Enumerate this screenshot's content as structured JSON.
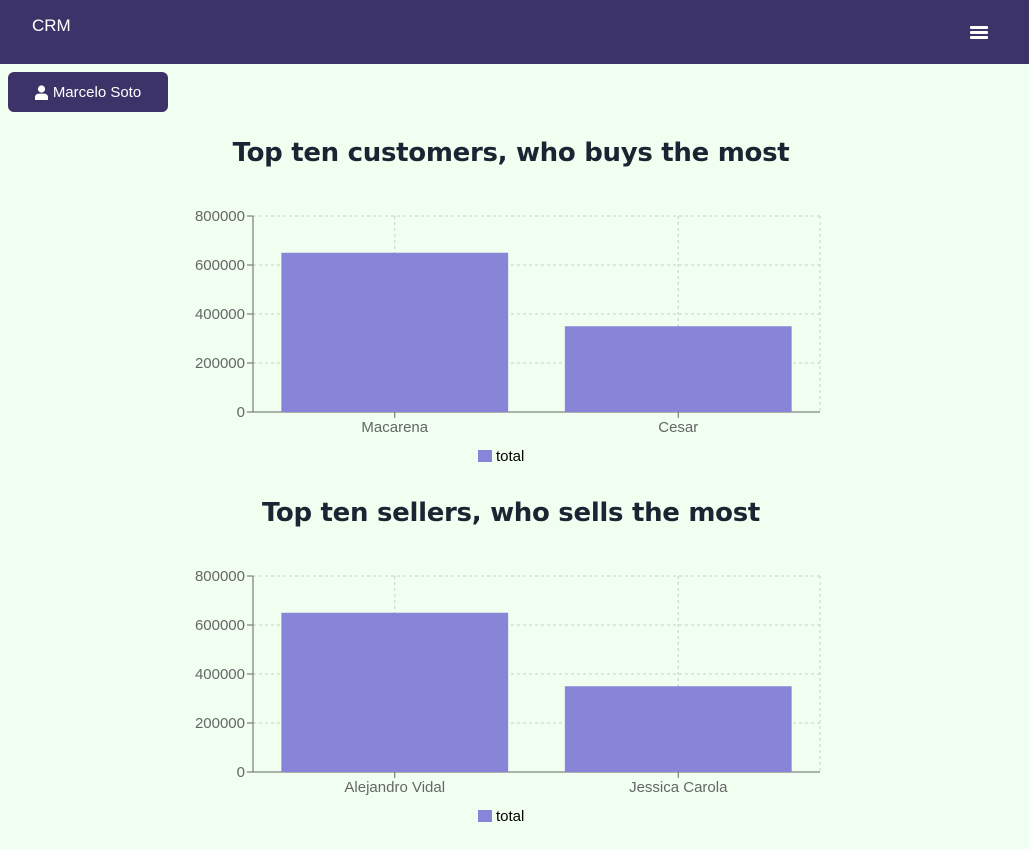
{
  "header": {
    "brand": "CRM",
    "menu_icon": "hamburger-menu-icon"
  },
  "user": {
    "name": "Marcelo Soto",
    "icon": "user-icon"
  },
  "colors": {
    "header_bg": "#3c3469",
    "page_bg": "#f0fff0",
    "bar_fill": "#8884d8",
    "title_text": "#1c2433"
  },
  "chart_data": [
    {
      "type": "bar",
      "title": "Top ten customers, who buys the most",
      "categories": [
        "Macarena",
        "Cesar"
      ],
      "series": [
        {
          "name": "total",
          "values": [
            650000,
            350000
          ]
        }
      ],
      "yticks": [
        "0",
        "200000",
        "400000",
        "600000",
        "800000"
      ],
      "ylim": [
        0,
        800000
      ],
      "grid": true,
      "legend": "bottom-center"
    },
    {
      "type": "bar",
      "title": "Top ten sellers, who sells the most",
      "categories": [
        "Alejandro Vidal",
        "Jessica Carola"
      ],
      "series": [
        {
          "name": "total",
          "values": [
            650000,
            350000
          ]
        }
      ],
      "yticks": [
        "0",
        "200000",
        "400000",
        "600000",
        "800000"
      ],
      "ylim": [
        0,
        800000
      ],
      "grid": true,
      "legend": "bottom-center"
    }
  ]
}
